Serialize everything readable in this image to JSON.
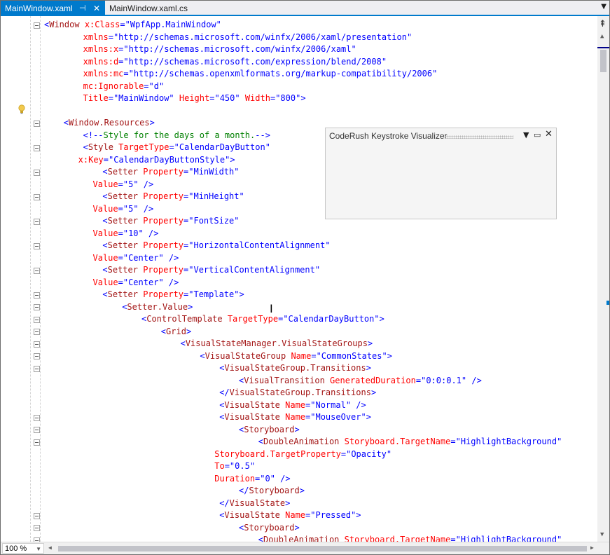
{
  "tabs": [
    {
      "label": "MainWindow.xaml",
      "active": true
    },
    {
      "label": "MainWindow.xaml.cs",
      "active": false
    }
  ],
  "panel": {
    "title": "CodeRush Keystroke Visualizer"
  },
  "zoom": "100 %",
  "colors": {
    "accent": "#007acc",
    "element": "#a31515",
    "attribute": "#ff0000",
    "value": "#0000ff",
    "comment": "#008000"
  },
  "lines": [
    {
      "indent": 0,
      "fold": true,
      "tokens": [
        [
          "b",
          "<"
        ],
        [
          "e",
          "Window"
        ],
        [
          "a",
          " x:Class"
        ],
        [
          "b",
          "=\""
        ],
        [
          "v",
          "WpfApp.MainWindow"
        ],
        [
          "b",
          "\""
        ]
      ]
    },
    {
      "indent": 8,
      "tokens": [
        [
          "a",
          "xmlns"
        ],
        [
          "b",
          "=\""
        ],
        [
          "v",
          "http://schemas.microsoft.com/winfx/2006/xaml/presentation"
        ],
        [
          "b",
          "\""
        ]
      ]
    },
    {
      "indent": 8,
      "tokens": [
        [
          "a",
          "xmlns:x"
        ],
        [
          "b",
          "=\""
        ],
        [
          "v",
          "http://schemas.microsoft.com/winfx/2006/xaml"
        ],
        [
          "b",
          "\""
        ]
      ]
    },
    {
      "indent": 8,
      "tokens": [
        [
          "a",
          "xmlns:d"
        ],
        [
          "b",
          "=\""
        ],
        [
          "v",
          "http://schemas.microsoft.com/expression/blend/2008"
        ],
        [
          "b",
          "\""
        ]
      ]
    },
    {
      "indent": 8,
      "tokens": [
        [
          "a",
          "xmlns:mc"
        ],
        [
          "b",
          "=\""
        ],
        [
          "v",
          "http://schemas.openxmlformats.org/markup-compatibility/2006"
        ],
        [
          "b",
          "\""
        ]
      ]
    },
    {
      "indent": 8,
      "tokens": [
        [
          "a",
          "mc:Ignorable"
        ],
        [
          "b",
          "=\""
        ],
        [
          "v",
          "d"
        ],
        [
          "b",
          "\""
        ]
      ]
    },
    {
      "indent": 8,
      "tokens": [
        [
          "a",
          "Title"
        ],
        [
          "b",
          "=\""
        ],
        [
          "v",
          "MainWindow"
        ],
        [
          "b",
          "\""
        ],
        [
          "a",
          " Height"
        ],
        [
          "b",
          "=\""
        ],
        [
          "v",
          "450"
        ],
        [
          "b",
          "\""
        ],
        [
          "a",
          " Width"
        ],
        [
          "b",
          "=\""
        ],
        [
          "v",
          "800"
        ],
        [
          "b",
          "\">"
        ]
      ]
    },
    {
      "indent": 0,
      "tokens": []
    },
    {
      "indent": 4,
      "fold": true,
      "tokens": [
        [
          "b",
          "<"
        ],
        [
          "e",
          "Window.Resources"
        ],
        [
          "b",
          ">"
        ]
      ]
    },
    {
      "indent": 8,
      "tokens": [
        [
          "b",
          "<!--"
        ],
        [
          "c",
          "Style for the days of a month."
        ],
        [
          "b",
          "-->"
        ]
      ]
    },
    {
      "indent": 8,
      "fold": true,
      "tokens": [
        [
          "b",
          "<"
        ],
        [
          "e",
          "Style"
        ],
        [
          "a",
          " TargetType"
        ],
        [
          "b",
          "=\""
        ],
        [
          "v",
          "CalendarDayButton"
        ],
        [
          "b",
          "\""
        ]
      ]
    },
    {
      "indent": 7,
      "tokens": [
        [
          "a",
          "x:Key"
        ],
        [
          "b",
          "=\""
        ],
        [
          "v",
          "CalendarDayButtonStyle"
        ],
        [
          "b",
          "\">"
        ]
      ]
    },
    {
      "indent": 12,
      "fold": true,
      "tokens": [
        [
          "b",
          "<"
        ],
        [
          "e",
          "Setter"
        ],
        [
          "a",
          " Property"
        ],
        [
          "b",
          "=\""
        ],
        [
          "v",
          "MinWidth"
        ],
        [
          "b",
          "\""
        ]
      ]
    },
    {
      "indent": 10,
      "tokens": [
        [
          "a",
          "Value"
        ],
        [
          "b",
          "=\""
        ],
        [
          "v",
          "5"
        ],
        [
          "b",
          "\" />"
        ]
      ]
    },
    {
      "indent": 12,
      "fold": true,
      "tokens": [
        [
          "b",
          "<"
        ],
        [
          "e",
          "Setter"
        ],
        [
          "a",
          " Property"
        ],
        [
          "b",
          "=\""
        ],
        [
          "v",
          "MinHeight"
        ],
        [
          "b",
          "\""
        ]
      ]
    },
    {
      "indent": 10,
      "tokens": [
        [
          "a",
          "Value"
        ],
        [
          "b",
          "=\""
        ],
        [
          "v",
          "5"
        ],
        [
          "b",
          "\" />"
        ]
      ]
    },
    {
      "indent": 12,
      "fold": true,
      "tokens": [
        [
          "b",
          "<"
        ],
        [
          "e",
          "Setter"
        ],
        [
          "a",
          " Property"
        ],
        [
          "b",
          "=\""
        ],
        [
          "v",
          "FontSize"
        ],
        [
          "b",
          "\""
        ]
      ]
    },
    {
      "indent": 10,
      "tokens": [
        [
          "a",
          "Value"
        ],
        [
          "b",
          "=\""
        ],
        [
          "v",
          "10"
        ],
        [
          "b",
          "\" />"
        ]
      ]
    },
    {
      "indent": 12,
      "fold": true,
      "tokens": [
        [
          "b",
          "<"
        ],
        [
          "e",
          "Setter"
        ],
        [
          "a",
          " Property"
        ],
        [
          "b",
          "=\""
        ],
        [
          "v",
          "HorizontalContentAlignment"
        ],
        [
          "b",
          "\""
        ]
      ]
    },
    {
      "indent": 10,
      "tokens": [
        [
          "a",
          "Value"
        ],
        [
          "b",
          "=\""
        ],
        [
          "v",
          "Center"
        ],
        [
          "b",
          "\" />"
        ]
      ]
    },
    {
      "indent": 12,
      "fold": true,
      "tokens": [
        [
          "b",
          "<"
        ],
        [
          "e",
          "Setter"
        ],
        [
          "a",
          " Property"
        ],
        [
          "b",
          "=\""
        ],
        [
          "v",
          "VerticalContentAlignment"
        ],
        [
          "b",
          "\""
        ]
      ]
    },
    {
      "indent": 10,
      "tokens": [
        [
          "a",
          "Value"
        ],
        [
          "b",
          "=\""
        ],
        [
          "v",
          "Center"
        ],
        [
          "b",
          "\" />"
        ]
      ]
    },
    {
      "indent": 12,
      "fold": true,
      "tokens": [
        [
          "b",
          "<"
        ],
        [
          "e",
          "Setter"
        ],
        [
          "a",
          " Property"
        ],
        [
          "b",
          "=\""
        ],
        [
          "v",
          "Template"
        ],
        [
          "b",
          "\">"
        ]
      ]
    },
    {
      "indent": 16,
      "fold": true,
      "tokens": [
        [
          "b",
          "<"
        ],
        [
          "e",
          "Setter.Value"
        ],
        [
          "b",
          ">"
        ]
      ]
    },
    {
      "indent": 20,
      "fold": true,
      "tokens": [
        [
          "b",
          "<"
        ],
        [
          "e",
          "ControlTemplate"
        ],
        [
          "a",
          " TargetType"
        ],
        [
          "b",
          "=\""
        ],
        [
          "v",
          "CalendarDayButton"
        ],
        [
          "b",
          "\">"
        ]
      ]
    },
    {
      "indent": 24,
      "fold": true,
      "tokens": [
        [
          "b",
          "<"
        ],
        [
          "e",
          "Grid"
        ],
        [
          "b",
          ">"
        ]
      ]
    },
    {
      "indent": 28,
      "fold": true,
      "tokens": [
        [
          "b",
          "<"
        ],
        [
          "e",
          "VisualStateManager.VisualStateGroups"
        ],
        [
          "b",
          ">"
        ]
      ]
    },
    {
      "indent": 32,
      "fold": true,
      "tokens": [
        [
          "b",
          "<"
        ],
        [
          "e",
          "VisualStateGroup"
        ],
        [
          "a",
          " Name"
        ],
        [
          "b",
          "=\""
        ],
        [
          "v",
          "CommonStates"
        ],
        [
          "b",
          "\">"
        ]
      ]
    },
    {
      "indent": 36,
      "fold": true,
      "tokens": [
        [
          "b",
          "<"
        ],
        [
          "e",
          "VisualStateGroup.Transitions"
        ],
        [
          "b",
          ">"
        ]
      ]
    },
    {
      "indent": 40,
      "tokens": [
        [
          "b",
          "<"
        ],
        [
          "e",
          "VisualTransition"
        ],
        [
          "a",
          " GeneratedDuration"
        ],
        [
          "b",
          "=\""
        ],
        [
          "v",
          "0:0:0.1"
        ],
        [
          "b",
          "\" />"
        ]
      ]
    },
    {
      "indent": 36,
      "tokens": [
        [
          "b",
          "</"
        ],
        [
          "e",
          "VisualStateGroup.Transitions"
        ],
        [
          "b",
          ">"
        ]
      ]
    },
    {
      "indent": 36,
      "tokens": [
        [
          "b",
          "<"
        ],
        [
          "e",
          "VisualState"
        ],
        [
          "a",
          " Name"
        ],
        [
          "b",
          "=\""
        ],
        [
          "v",
          "Normal"
        ],
        [
          "b",
          "\" />"
        ]
      ]
    },
    {
      "indent": 36,
      "fold": true,
      "tokens": [
        [
          "b",
          "<"
        ],
        [
          "e",
          "VisualState"
        ],
        [
          "a",
          " Name"
        ],
        [
          "b",
          "=\""
        ],
        [
          "v",
          "MouseOver"
        ],
        [
          "b",
          "\">"
        ]
      ]
    },
    {
      "indent": 40,
      "fold": true,
      "tokens": [
        [
          "b",
          "<"
        ],
        [
          "e",
          "Storyboard"
        ],
        [
          "b",
          ">"
        ]
      ]
    },
    {
      "indent": 44,
      "fold": true,
      "tokens": [
        [
          "b",
          "<"
        ],
        [
          "e",
          "DoubleAnimation"
        ],
        [
          "a",
          " Storyboard.TargetName"
        ],
        [
          "b",
          "=\""
        ],
        [
          "v",
          "HighlightBackground"
        ],
        [
          "b",
          "\""
        ]
      ]
    },
    {
      "indent": 35,
      "tokens": [
        [
          "a",
          "Storyboard.TargetProperty"
        ],
        [
          "b",
          "=\""
        ],
        [
          "v",
          "Opacity"
        ],
        [
          "b",
          "\""
        ]
      ]
    },
    {
      "indent": 35,
      "tokens": [
        [
          "a",
          "To"
        ],
        [
          "b",
          "=\""
        ],
        [
          "v",
          "0.5"
        ],
        [
          "b",
          "\""
        ]
      ]
    },
    {
      "indent": 35,
      "tokens": [
        [
          "a",
          "Duration"
        ],
        [
          "b",
          "=\""
        ],
        [
          "v",
          "0"
        ],
        [
          "b",
          "\" />"
        ]
      ]
    },
    {
      "indent": 40,
      "tokens": [
        [
          "b",
          "</"
        ],
        [
          "e",
          "Storyboard"
        ],
        [
          "b",
          ">"
        ]
      ]
    },
    {
      "indent": 36,
      "tokens": [
        [
          "b",
          "</"
        ],
        [
          "e",
          "VisualState"
        ],
        [
          "b",
          ">"
        ]
      ]
    },
    {
      "indent": 36,
      "fold": true,
      "tokens": [
        [
          "b",
          "<"
        ],
        [
          "e",
          "VisualState"
        ],
        [
          "a",
          " Name"
        ],
        [
          "b",
          "=\""
        ],
        [
          "v",
          "Pressed"
        ],
        [
          "b",
          "\">"
        ]
      ]
    },
    {
      "indent": 40,
      "fold": true,
      "tokens": [
        [
          "b",
          "<"
        ],
        [
          "e",
          "Storyboard"
        ],
        [
          "b",
          ">"
        ]
      ]
    },
    {
      "indent": 44,
      "fold": true,
      "tokens": [
        [
          "b",
          "<"
        ],
        [
          "e",
          "DoubleAnimation"
        ],
        [
          "a",
          " Storyboard.TargetName"
        ],
        [
          "b",
          "=\""
        ],
        [
          "v",
          "HighlightBackground"
        ],
        [
          "b",
          "\""
        ]
      ]
    }
  ]
}
